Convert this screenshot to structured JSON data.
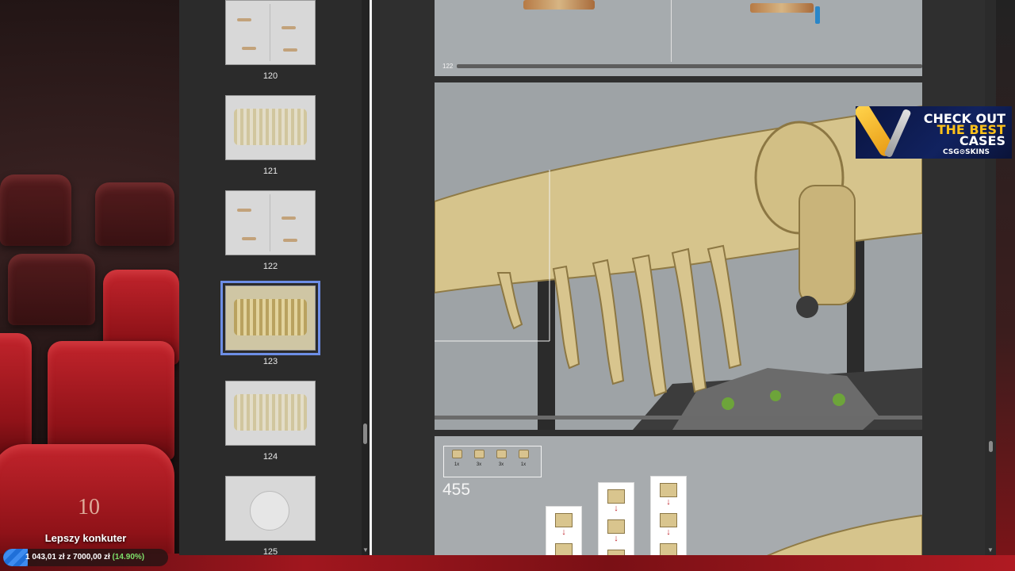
{
  "thumbnails": [
    {
      "label": "120",
      "active": false
    },
    {
      "label": "121",
      "active": false
    },
    {
      "label": "122",
      "active": false
    },
    {
      "label": "123",
      "active": true
    },
    {
      "label": "124",
      "active": false
    },
    {
      "label": "125",
      "active": false
    }
  ],
  "viewer": {
    "top_page_number": "122",
    "parts": [
      {
        "qty": "1x"
      },
      {
        "qty": "3x"
      },
      {
        "qty": "3x"
      },
      {
        "qty": "1x"
      }
    ],
    "step_number": "455"
  },
  "ad": {
    "line1": "CHECK OUT",
    "line2": "THE BEST",
    "line3": "CASES",
    "brand": "CSG⊙SKINS"
  },
  "background": {
    "seat_number": "10"
  },
  "goal": {
    "title": "Lepszy konkuter",
    "amount_text": "1 043,01 zł z 7000,00 zł",
    "percent_text": "(14.90%)",
    "progress": 0.149
  },
  "colors": {
    "active_thumb_outline": "#6d8ee6",
    "goal_fill": "#1f6fd8",
    "goal_percent": "#7ee06a",
    "ad_highlight": "#ffc21a"
  }
}
